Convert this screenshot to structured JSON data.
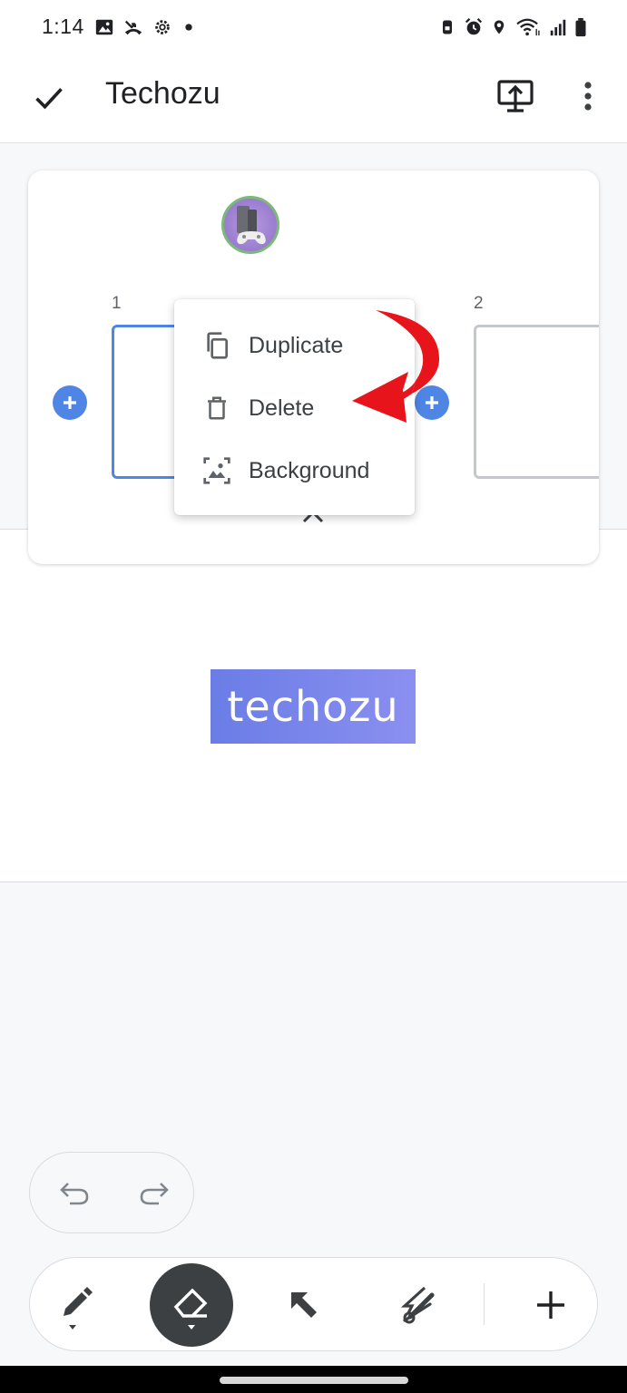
{
  "status_bar": {
    "time": "1:14",
    "left_icons": [
      "image-icon",
      "missed-call-icon",
      "gear-icon",
      "dot-icon"
    ],
    "right_icons": [
      "lock-rotate-icon",
      "alarm-icon",
      "location-icon",
      "wifi-icon",
      "signal-icon",
      "battery-icon"
    ]
  },
  "app_bar": {
    "title": "Techozu",
    "actions": [
      "check-icon",
      "present-icon",
      "more-vert-icon"
    ]
  },
  "frames_panel": {
    "frames": [
      {
        "number": "1",
        "selected": true
      },
      {
        "number": "2",
        "selected": false
      }
    ]
  },
  "context_menu": {
    "items": [
      {
        "label": "Duplicate",
        "icon": "copy-icon"
      },
      {
        "label": "Delete",
        "icon": "trash-icon"
      },
      {
        "label": "Background",
        "icon": "image-background-icon"
      }
    ]
  },
  "canvas": {
    "logo_text": "techozu"
  },
  "toolbar": {
    "tools": [
      "pen-icon",
      "eraser-icon",
      "pointer-icon",
      "laser-icon",
      "plus-icon"
    ],
    "active_tool": "eraser"
  },
  "colors": {
    "accent": "#4f86e6",
    "annotation_arrow": "#e8141c",
    "logo_background": "#7a86ea",
    "active_tool": "#3c4043"
  }
}
